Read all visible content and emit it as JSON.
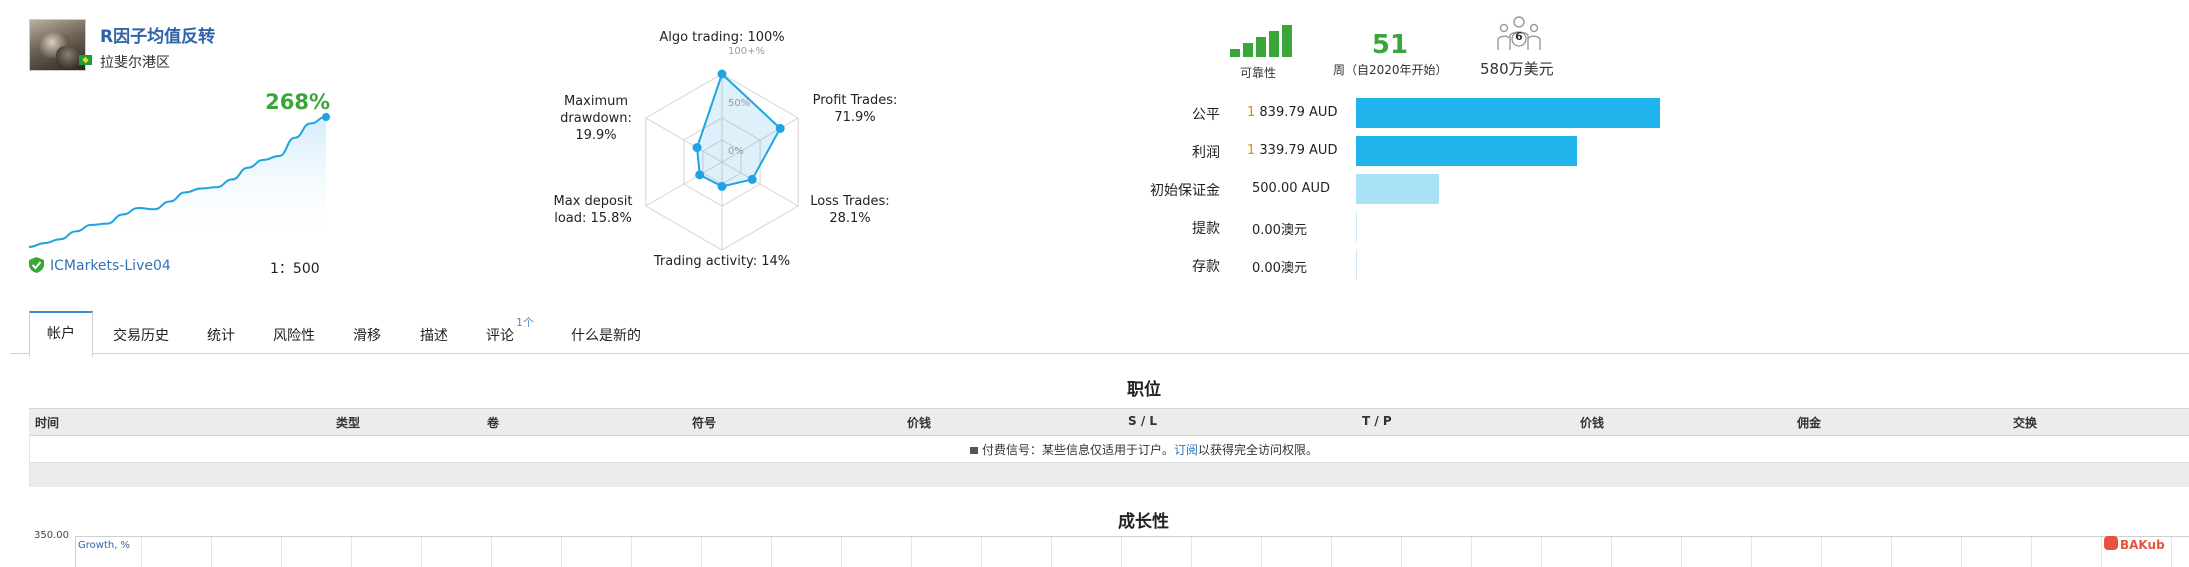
{
  "profile": {
    "name": "R因子均值反转",
    "region": "拉斐尔港区",
    "growth": "268%",
    "broker": "ICMarkets-Live04",
    "leverage": "1：500",
    "growth_curve": [
      0.0,
      0.03,
      0.06,
      0.12,
      0.17,
      0.18,
      0.25,
      0.3,
      0.29,
      0.35,
      0.42,
      0.45,
      0.46,
      0.52,
      0.61,
      0.67,
      0.7,
      0.84,
      0.95,
      1.0
    ],
    "colors": {
      "name": "#2f64a8",
      "growth": "#3aa63a",
      "curve": "#1fa3e3"
    }
  },
  "radar": {
    "labels": {
      "algo": "Algo trading: 100%",
      "profit_l1": "Profit Trades:",
      "profit_l2": "71.9%",
      "loss_l1": "Loss Trades:",
      "loss_l2": "28.1%",
      "activity": "Trading activity: 14%",
      "deposit_l1": "Max deposit",
      "deposit_l2": "load: 15.8%",
      "drawdown_l1": "Maximum",
      "drawdown_l2": "drawdown:",
      "drawdown_l3": "19.9%"
    },
    "ticks": [
      "100+%",
      "50%",
      "0%"
    ],
    "values": [
      1.0,
      0.719,
      0.281,
      0.14,
      0.158,
      0.199
    ]
  },
  "stats": {
    "reliability_label": "可靠性",
    "reliability_level": 5,
    "weeks": "51",
    "weeks_label": "周（自2020年开始）",
    "subscribers_label": "580万美元",
    "subscribers_count": "6",
    "rows": [
      {
        "label": "公平",
        "digit": "1",
        "value": " 839.79 AUD",
        "fraction": 1.0,
        "color": "#1fb5ec"
      },
      {
        "label": "利润",
        "digit": "1",
        "value": " 339.79 AUD",
        "fraction": 0.728,
        "color": "#1fb5ec"
      },
      {
        "label": "初始保证金",
        "digit": "",
        "value": "500.00 AUD",
        "fraction": 0.272,
        "color": "#a9e1f7"
      },
      {
        "label": "提款",
        "digit": "",
        "value": "0.00澳元",
        "fraction": 0.0,
        "color": "#a9e1f7"
      },
      {
        "label": "存款",
        "digit": "",
        "value": "0.00澳元",
        "fraction": 0.0,
        "color": "#a9e1f7"
      }
    ]
  },
  "tabs": [
    "帐户",
    "交易历史",
    "统计",
    "风险性",
    "滑移",
    "描述",
    "评论",
    "什么是新的"
  ],
  "tab_badge": "1个",
  "positions": {
    "title": "职位",
    "columns": [
      "时间",
      "类型",
      "卷",
      "符号",
      "价钱",
      "S / L",
      "T / P",
      "价钱",
      "佣金",
      "交换"
    ],
    "notice_prefix": "付费信号：某些信息仅适用于订户。",
    "notice_link": "订阅",
    "notice_suffix": "以获得完全访问权限。"
  },
  "growth_section": {
    "title": "成长性",
    "y_top": "350.00",
    "chart_title": "Growth, %"
  },
  "watermark": "BAKub"
}
